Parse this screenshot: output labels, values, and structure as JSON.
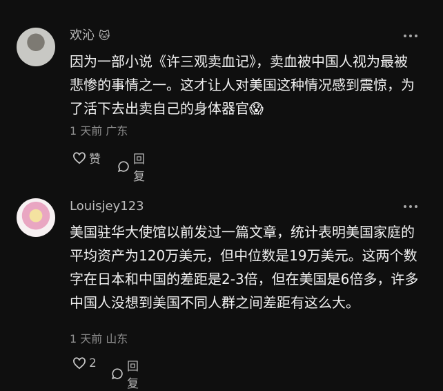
{
  "comments": [
    {
      "username": "欢沁",
      "username_emoji": "🐱",
      "text": "因为一部小说《许三观卖血记》，卖血被中国人视为最被悲惨的事情之一。这才让人对美国这种情况感到震惊，为了活下去出卖自己的身体器官😱",
      "time": "1 天前",
      "location": "广东",
      "like_label": "赞",
      "reply_label": "回复"
    },
    {
      "username": "Louisjey123",
      "username_emoji": "",
      "text": "美国驻华大使馆以前发过一篇文章，统计表明美国家庭的平均资产为120万美元，但中位数是19万美元。这两个数字在日本和中国的差距是2-3倍，但在美国是6倍多，许多中国人没想到美国不同人群之间差距有这么大。",
      "time": "1 天前",
      "location": "山东",
      "like_label": "2",
      "reply_label": "回复"
    }
  ],
  "icons": {
    "like": "heart-icon",
    "reply": "comment-bubble-icon",
    "more": "more-icon"
  }
}
